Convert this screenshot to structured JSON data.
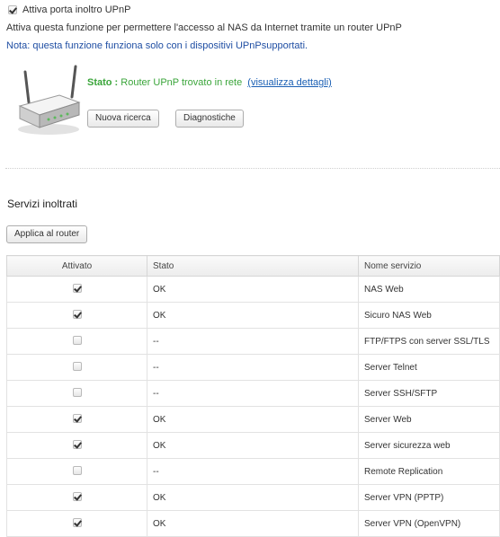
{
  "upnp": {
    "enable_label": "Attiva porta inoltro UPnP",
    "enable_checked": true,
    "description": "Attiva questa funzione per permettere l'accesso al NAS da Internet tramite un router UPnP",
    "note": "Nota: questa funzione funziona solo con i dispositivi UPnPsupportati.",
    "status_label": "Stato :",
    "status_value": "Router UPnP trovato in rete",
    "details_link": "(visualizza dettagli)",
    "rescan_button": "Nuova ricerca",
    "diagnostics_button": "Diagnostiche",
    "router_icon": "router-icon"
  },
  "forwarded": {
    "section_title": "Servizi inoltrati",
    "apply_button": "Applica al router",
    "columns": [
      "Attivato",
      "Stato",
      "Nome servizio"
    ],
    "rows": [
      {
        "enabled": true,
        "status": "OK",
        "name": "NAS Web"
      },
      {
        "enabled": true,
        "status": "OK",
        "name": "Sicuro NAS Web"
      },
      {
        "enabled": false,
        "status": "--",
        "name": "FTP/FTPS con server SSL/TLS"
      },
      {
        "enabled": false,
        "status": "--",
        "name": "Server Telnet"
      },
      {
        "enabled": false,
        "status": "--",
        "name": "Server SSH/SFTP"
      },
      {
        "enabled": true,
        "status": "OK",
        "name": "Server Web"
      },
      {
        "enabled": true,
        "status": "OK",
        "name": "Server sicurezza web"
      },
      {
        "enabled": false,
        "status": "--",
        "name": "Remote Replication"
      },
      {
        "enabled": true,
        "status": "OK",
        "name": "Server VPN (PPTP)"
      },
      {
        "enabled": true,
        "status": "OK",
        "name": "Server VPN (OpenVPN)"
      }
    ]
  },
  "colors": {
    "status_green": "#3aa53a",
    "note_blue": "#1f4ea3",
    "link_blue": "#1a5fb4"
  }
}
